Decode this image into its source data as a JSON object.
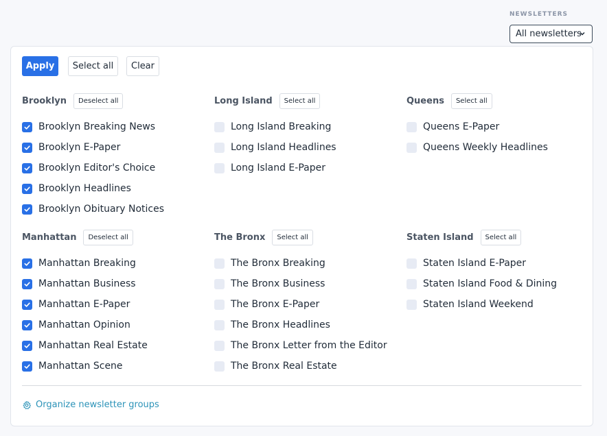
{
  "header": {
    "label": "NEWSLETTERS",
    "dropdown_value": "All newsletters"
  },
  "toolbar": {
    "apply": "Apply",
    "select_all": "Select all",
    "clear": "Clear"
  },
  "groups": [
    {
      "title": "Brooklyn",
      "action": "Deselect all",
      "items": [
        {
          "label": "Brooklyn Breaking News",
          "checked": true
        },
        {
          "label": "Brooklyn E-Paper",
          "checked": true
        },
        {
          "label": "Brooklyn Editor's Choice",
          "checked": true
        },
        {
          "label": "Brooklyn Headlines",
          "checked": true
        },
        {
          "label": "Brooklyn Obituary Notices",
          "checked": true
        }
      ]
    },
    {
      "title": "Long Island",
      "action": "Select all",
      "items": [
        {
          "label": "Long Island Breaking",
          "checked": false
        },
        {
          "label": "Long Island Headlines",
          "checked": false
        },
        {
          "label": "Long Island E-Paper",
          "checked": false
        }
      ]
    },
    {
      "title": "Queens",
      "action": "Select all",
      "items": [
        {
          "label": "Queens E-Paper",
          "checked": false
        },
        {
          "label": "Queens Weekly Headlines",
          "checked": false
        }
      ]
    },
    {
      "title": "Manhattan",
      "action": "Deselect all",
      "items": [
        {
          "label": "Manhattan Breaking",
          "checked": true
        },
        {
          "label": "Manhattan Business",
          "checked": true
        },
        {
          "label": "Manhattan E-Paper",
          "checked": true
        },
        {
          "label": "Manhattan Opinion",
          "checked": true
        },
        {
          "label": "Manhattan Real Estate",
          "checked": true
        },
        {
          "label": "Manhattan Scene",
          "checked": true
        }
      ]
    },
    {
      "title": "The Bronx",
      "action": "Select all",
      "items": [
        {
          "label": "The Bronx Breaking",
          "checked": false
        },
        {
          "label": "The Bronx Business",
          "checked": false
        },
        {
          "label": "The Bronx E-Paper",
          "checked": false
        },
        {
          "label": "The Bronx Headlines",
          "checked": false
        },
        {
          "label": "The Bronx Letter from the Editor",
          "checked": false
        },
        {
          "label": "The Bronx Real Estate",
          "checked": false
        }
      ]
    },
    {
      "title": "Staten Island",
      "action": "Select all",
      "items": [
        {
          "label": "Staten Island E-Paper",
          "checked": false
        },
        {
          "label": "Staten Island Food & Dining",
          "checked": false
        },
        {
          "label": "Staten Island Weekend",
          "checked": false
        }
      ]
    }
  ],
  "footer": {
    "link": "Organize newsletter groups",
    "icon": "gear-icon"
  },
  "colors": {
    "accent": "#2970e6",
    "link": "#2c93b8"
  }
}
